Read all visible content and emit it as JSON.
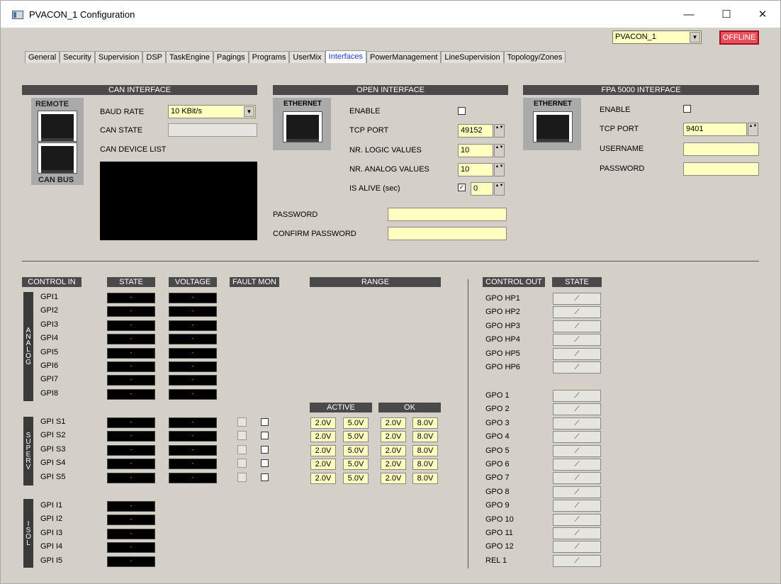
{
  "window": {
    "title": "PVACON_1 Configuration",
    "minimize_glyph": "—",
    "maximize_glyph": "☐",
    "close_glyph": "✕"
  },
  "device_selector": {
    "value": "PVACON_1",
    "arrow": "▼"
  },
  "status": {
    "text": "OFFLINE",
    "color": "#e8505e"
  },
  "tabs": [
    "General",
    "Security",
    "Supervision",
    "DSP",
    "TaskEngine",
    "Pagings",
    "Programs",
    "UserMix",
    "Interfaces",
    "PowerManagement",
    "LineSupervision",
    "Topology/Zones"
  ],
  "active_tab": "Interfaces",
  "spin": "▲▼",
  "can": {
    "header": "CAN INTERFACE",
    "remote": "REMOTE",
    "canbus": "CAN BUS",
    "baud_label": "BAUD RATE",
    "baud_value": "10 KBit/s",
    "state_label": "CAN STATE",
    "list_label": "CAN DEVICE LIST"
  },
  "open": {
    "header": "OPEN INTERFACE",
    "ethernet": "ETHERNET",
    "enable_label": "ENABLE",
    "tcp_label": "TCP PORT",
    "tcp_value": "49152",
    "logic_label": "NR. LOGIC VALUES",
    "logic_value": "10",
    "analog_label": "NR. ANALOG VALUES",
    "analog_value": "10",
    "alive_label": "IS ALIVE (sec)",
    "alive_check": "✓",
    "alive_value": "0",
    "password_label": "PASSWORD",
    "confirm_label": "CONFIRM PASSWORD"
  },
  "fpa": {
    "header": "FPA 5000 INTERFACE",
    "ethernet": "ETHERNET",
    "enable_label": "ENABLE",
    "tcp_label": "TCP PORT",
    "tcp_value": "9401",
    "username_label": "USERNAME",
    "password_label": "PASSWORD"
  },
  "cols": {
    "control_in": "CONTROL IN",
    "state": "STATE",
    "voltage": "VOLTAGE",
    "fault_mon": "FAULT MON",
    "range": "RANGE",
    "active": "ACTIVE",
    "ok": "OK",
    "control_out": "CONTROL OUT",
    "state_out": "STATE"
  },
  "groups": {
    "analog": "ANALOG",
    "superv": "SUPERV",
    "isol": "ISOL"
  },
  "led_value": "-",
  "analog_inputs": [
    "GPI1",
    "GPI2",
    "GPI3",
    "GPI4",
    "GPI5",
    "GPI6",
    "GPI7",
    "GPI8"
  ],
  "superv_inputs": [
    {
      "name": "GPI S1",
      "active_lo": "2.0V",
      "active_hi": "5.0V",
      "ok_lo": "2.0V",
      "ok_hi": "8.0V"
    },
    {
      "name": "GPI S2",
      "active_lo": "2.0V",
      "active_hi": "5.0V",
      "ok_lo": "2.0V",
      "ok_hi": "8.0V"
    },
    {
      "name": "GPI S3",
      "active_lo": "2.0V",
      "active_hi": "5.0V",
      "ok_lo": "2.0V",
      "ok_hi": "8.0V"
    },
    {
      "name": "GPI S4",
      "active_lo": "2.0V",
      "active_hi": "5.0V",
      "ok_lo": "2.0V",
      "ok_hi": "8.0V"
    },
    {
      "name": "GPI S5",
      "active_lo": "2.0V",
      "active_hi": "5.0V",
      "ok_lo": "2.0V",
      "ok_hi": "8.0V"
    }
  ],
  "isol_inputs": [
    "GPI I1",
    "GPI I2",
    "GPI I3",
    "GPI I4",
    "GPI I5"
  ],
  "hp_outputs": [
    "GPO HP1",
    "GPO HP2",
    "GPO HP3",
    "GPO HP4",
    "GPO HP5",
    "GPO HP6"
  ],
  "gpo_outputs": [
    "GPO 1",
    "GPO 2",
    "GPO 3",
    "GPO 4",
    "GPO 5",
    "GPO 6",
    "GPO 7",
    "GPO 8",
    "GPO 9",
    "GPO 10",
    "GPO 11",
    "GPO 12",
    "REL 1"
  ],
  "relay_icon": "open-switch-icon",
  "relay_glyph": "⟋"
}
